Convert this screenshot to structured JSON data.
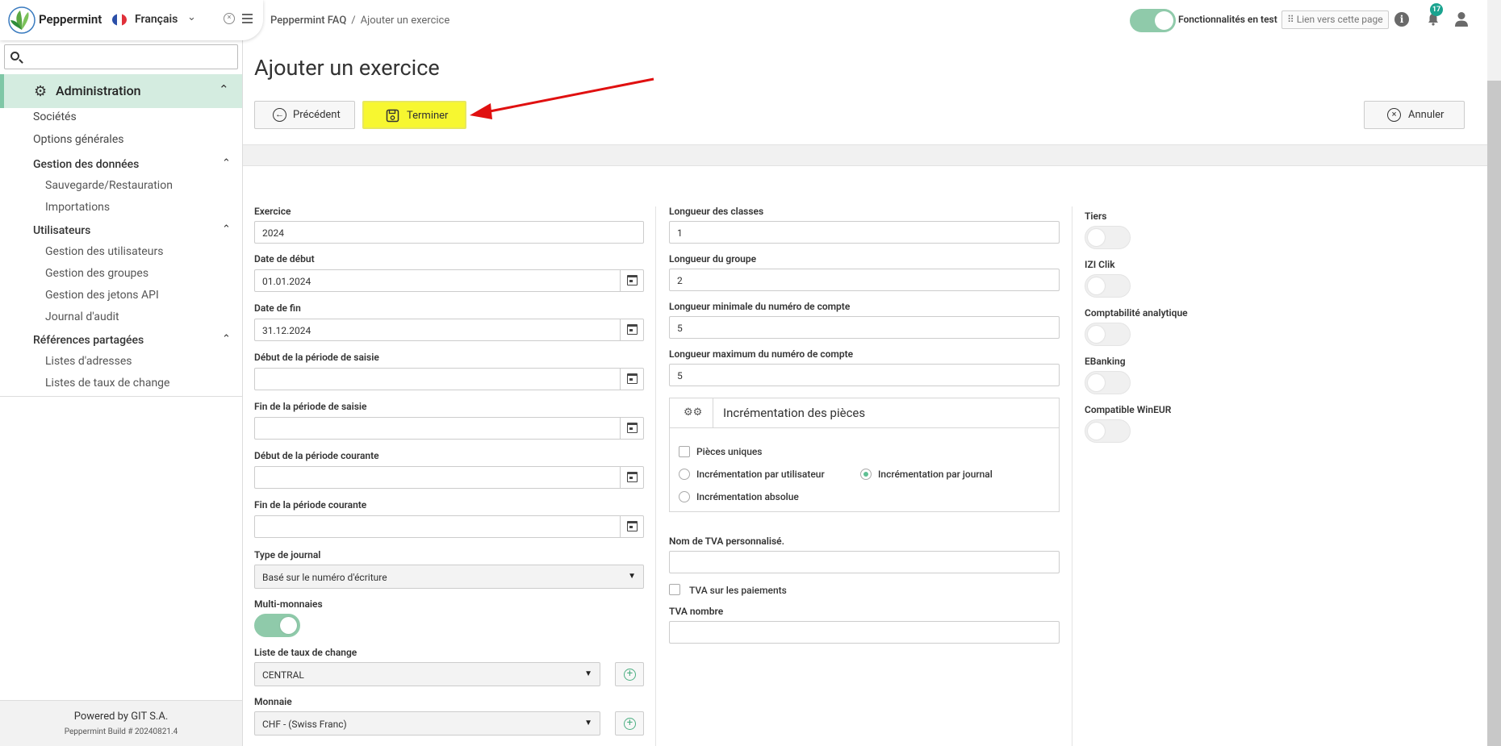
{
  "header": {
    "brand": "Peppermint",
    "language": "Français",
    "breadcrumb": [
      "Peppermint FAQ",
      "Ajouter un exercice"
    ],
    "beta_label": "Fonctionnalités en test",
    "page_link": "⠿ Lien vers cette page",
    "notif_count": "17"
  },
  "sidebar": {
    "search_placeholder": "",
    "section": "Administration",
    "items": [
      "Sociétés",
      "Options générales"
    ],
    "groups": [
      {
        "label": "Gestion des données",
        "items": [
          "Sauvegarde/Restauration",
          "Importations"
        ]
      },
      {
        "label": "Utilisateurs",
        "items": [
          "Gestion des utilisateurs",
          "Gestion des groupes",
          "Gestion des jetons API",
          "Journal d'audit"
        ]
      },
      {
        "label": "Références partagées",
        "items": [
          "Listes d'adresses",
          "Listes de taux de change"
        ]
      }
    ],
    "footer_powered": "Powered by GIT S.A.",
    "footer_build": "Peppermint Build # 20240821.4"
  },
  "main": {
    "title": "Ajouter un exercice",
    "btn_prev": "Précédent",
    "btn_finish": "Terminer",
    "btn_cancel": "Annuler"
  },
  "form_left": {
    "exercice_label": "Exercice",
    "exercice_value": "2024",
    "start_label": "Date de début",
    "start_value": "01.01.2024",
    "end_label": "Date de fin",
    "end_value": "31.12.2024",
    "entry_start_label": "Début de la période de saisie",
    "entry_end_label": "Fin de la période de saisie",
    "current_start_label": "Début de la période courante",
    "current_end_label": "Fin de la période courante",
    "journal_type_label": "Type de journal",
    "journal_type_value": "Basé sur le numéro d'écriture",
    "multicurrency_label": "Multi-monnaies",
    "multicurrency_on": true,
    "rate_list_label": "Liste de taux de change",
    "rate_list_value": "CENTRAL",
    "currency_label": "Monnaie",
    "currency_value": "CHF - (Swiss Franc)"
  },
  "form_middle": {
    "class_len_label": "Longueur des classes",
    "class_len_value": "1",
    "group_len_label": "Longueur du groupe",
    "group_len_value": "2",
    "min_len_label": "Longueur minimale du numéro de compte",
    "min_len_value": "5",
    "max_len_label": "Longueur maximum du numéro de compte",
    "max_len_value": "5",
    "incr_title": "Incrémentation des pièces",
    "unique_label": "Pièces uniques",
    "unique_checked": false,
    "incr_user_label": "Incrémentation par utilisateur",
    "incr_journal_label": "Incrémentation par journal",
    "incr_absolute_label": "Incrémentation absolue",
    "incr_selected": "journal",
    "vat_name_label": "Nom de TVA personnalisé.",
    "vat_payments_label": "TVA sur les paiements",
    "vat_payments_checked": false,
    "vat_number_label": "TVA nombre"
  },
  "form_right": {
    "toggles": [
      {
        "label": "Tiers",
        "on": false
      },
      {
        "label": "IZI Clik",
        "on": false
      },
      {
        "label": "Comptabilité analytique",
        "on": false
      },
      {
        "label": "EBanking",
        "on": false
      },
      {
        "label": "Compatible WinEUR",
        "on": false
      }
    ]
  },
  "colors": {
    "accent": "#8fcaaa",
    "highlight": "#f7f730",
    "arrow": "#e01010",
    "active_nav": "#d4ece0"
  }
}
